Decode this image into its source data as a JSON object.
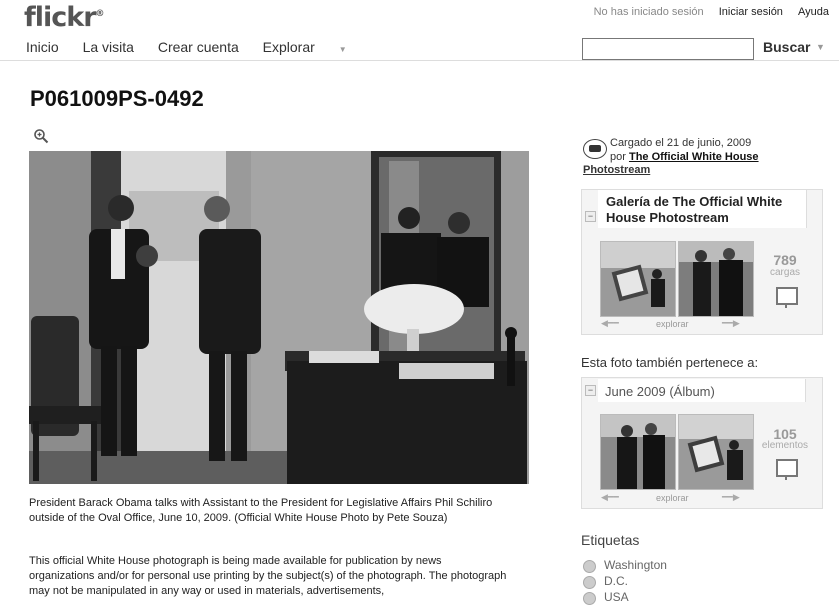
{
  "header": {
    "logo_text": "flickr",
    "logo_mark": "®",
    "signin_status": "No has iniciado sesión",
    "signin_link": "Iniciar sesión",
    "help_link": "Ayuda"
  },
  "nav": {
    "items": [
      "Inicio",
      "La visita",
      "Crear cuenta",
      "Explorar"
    ],
    "search_label": "Buscar",
    "search_value": ""
  },
  "photo": {
    "title": "P061009PS-0492",
    "caption": "President Barack Obama talks with Assistant to the President for Legislative Affairs Phil Schiliro outside of the Oval Office, June 10, 2009. (Official White House Photo by Pete Souza)",
    "notice": "This official White House photograph is being made available for publication by news organizations and/or for personal use printing by the subject(s) of the photograph. The photograph may not be manipulated in any way or used in materials, advertisements,"
  },
  "sidebar": {
    "uploaded_line": "Cargado el 21 de junio, 2009",
    "by_prefix": "por",
    "owner_part1": "The Official White House",
    "owner_part2": "Photostream",
    "gallery_title": "Galería de The Official White House Photostream",
    "gallery_count": "789",
    "gallery_count_label": "cargas",
    "gallery_strip_label": "explorar",
    "also_belongs": "Esta foto también pertenece a:",
    "album_title": "June 2009 (Álbum)",
    "album_count": "105",
    "album_count_label": "elementos",
    "album_strip_label": "explorar",
    "tags_heading": "Etiquetas",
    "tags": [
      "Washington",
      "D.C.",
      "USA"
    ]
  },
  "icons": {
    "zoom": "magnifier-plus-icon",
    "slideshow": "slideshow-icon",
    "tag": "globe-icon",
    "owner": "white-house-seal-icon"
  }
}
